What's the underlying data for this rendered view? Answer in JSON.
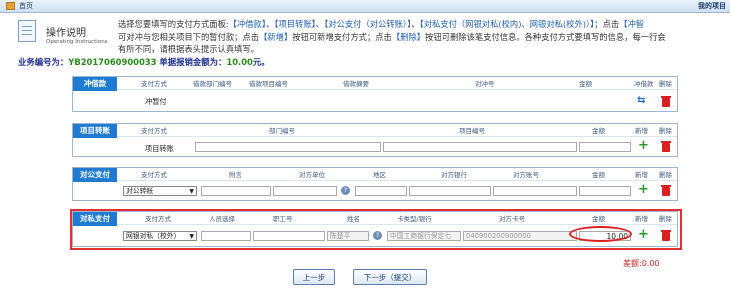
{
  "topbar": {
    "home": "首页",
    "right": "我的项目"
  },
  "guide": {
    "title": "操作说明",
    "subtitle": "Operating Instructions"
  },
  "description": {
    "line1_pre": "选择您要填写的支付方式面板:",
    "types": [
      "【冲借款】",
      "、",
      "【项目转账】",
      "、",
      "【对公支付（对公转账）】",
      "、",
      "【对私支付（网银对私(校内)、网银对私(校外)）】"
    ],
    "line1_post": "；点击",
    "line1_tail": "【冲智",
    "line2": "可对冲与您相关项目下的暂付款；点击",
    "add": "【新增】",
    "line2_mid": "按钮可新增支付方式；点击",
    "del": "【删除】",
    "line2_end": "按钮可删除该笔支付信息。各种支付方式要填写的信息，每一行会",
    "line3": "有所不同，请根据表头提示认真填写。"
  },
  "biz": {
    "label": "业务编号为：",
    "id": "YB2017060900033",
    "amount_label": "单据报销金额为：",
    "amount": "10.00",
    "unit": "元。"
  },
  "sections": {
    "loan": {
      "label": "冲借款",
      "headers": [
        "支付方式",
        "借款部门编号",
        "借款项目编号",
        "借款摘要",
        "对冲号",
        "金额",
        "冲借款",
        "删除"
      ],
      "method": "冲暂付"
    },
    "project": {
      "label": "项目转账",
      "headers": [
        "支付方式",
        "部门编号",
        "项目编号",
        "金额",
        "新增",
        "删除"
      ],
      "method": "项目转账"
    },
    "corporate": {
      "label": "对公支付",
      "headers": [
        "支付方式",
        "附言",
        "对方单位",
        "地区",
        "对方银行",
        "对方账号",
        "金额",
        "新增",
        "删除"
      ],
      "method": "对公转帐"
    },
    "private": {
      "label": "对私支付",
      "headers": [
        "支付方式",
        "人员选择",
        "职工号",
        "姓名",
        "卡类型/银行",
        "对方卡号",
        "金额",
        "新增",
        "删除"
      ],
      "method": "网银对私（校外）",
      "name": "陈楚平",
      "bank": "中国工商银行保定七",
      "card": "040900200900000",
      "amount": "10.00"
    }
  },
  "diff": "差额:0.00",
  "buttons": {
    "prev": "上一步",
    "next": "下一步（提交）"
  }
}
